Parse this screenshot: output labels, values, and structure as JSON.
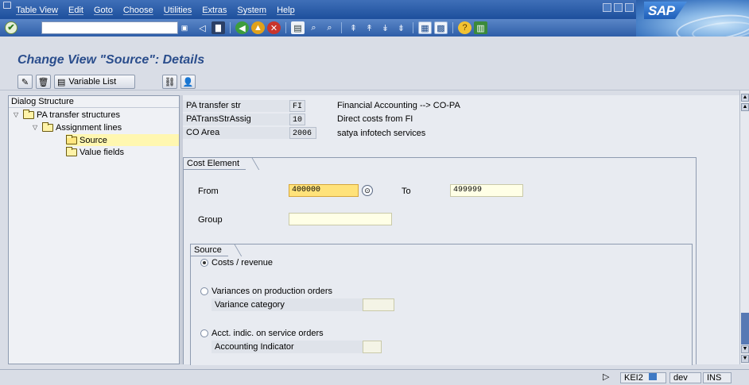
{
  "menubar": {
    "items": [
      "Table View",
      "Edit",
      "Goto",
      "Choose",
      "Utilities",
      "Extras",
      "System",
      "Help"
    ]
  },
  "brand": {
    "logo_text": "SAP"
  },
  "stdtoolbar": {
    "command_value": "",
    "icons": [
      "save-icon",
      "back-icon",
      "exit-icon",
      "cancel-icon",
      "print-icon",
      "find-icon",
      "find-next-icon",
      "first-page-icon",
      "previous-page-icon",
      "next-page-icon",
      "last-page-icon",
      "create-session-icon",
      "shortcut-icon",
      "help-icon",
      "layout-menu-icon"
    ]
  },
  "page": {
    "title": "Change View \"Source\": Details"
  },
  "apptoolbar": {
    "variable_list_label": "Variable List"
  },
  "dialog_structure": {
    "header": "Dialog Structure",
    "items": [
      {
        "label": "PA transfer structures"
      },
      {
        "label": "Assignment lines"
      },
      {
        "label": "Source"
      },
      {
        "label": "Value fields"
      }
    ]
  },
  "header_fields": [
    {
      "label": "PA transfer str",
      "value": "FI",
      "description": "Financial Accounting --> CO-PA"
    },
    {
      "label": "PATransStrAssig",
      "value": "10",
      "description": "Direct costs from FI"
    },
    {
      "label": "CO Area",
      "value": "2006",
      "description": "satya infotech services"
    }
  ],
  "cost_element": {
    "group_title": "Cost Element",
    "from_label": "From",
    "from_value": "400000",
    "to_label": "To",
    "to_value": "499999",
    "group_label": "Group",
    "group_value": ""
  },
  "source": {
    "group_title": "Source",
    "options": [
      {
        "label": "Costs / revenue",
        "selected": true
      },
      {
        "label": "Variances on production orders",
        "selected": false
      },
      {
        "label": "Acct. indic. on service orders",
        "selected": false
      }
    ],
    "variance_category_label": "Variance category",
    "variance_category_value": "",
    "accounting_indicator_label": "Accounting Indicator",
    "accounting_indicator_value": ""
  },
  "statusbar": {
    "transaction": "KEI2",
    "system": "dev",
    "mode": "INS"
  },
  "colors": {
    "title_blue": "#2a4d8c",
    "menubar": "#1d4f9c",
    "focused_input": "#ffe27a",
    "selected_tree_item": "#fff7b0"
  }
}
